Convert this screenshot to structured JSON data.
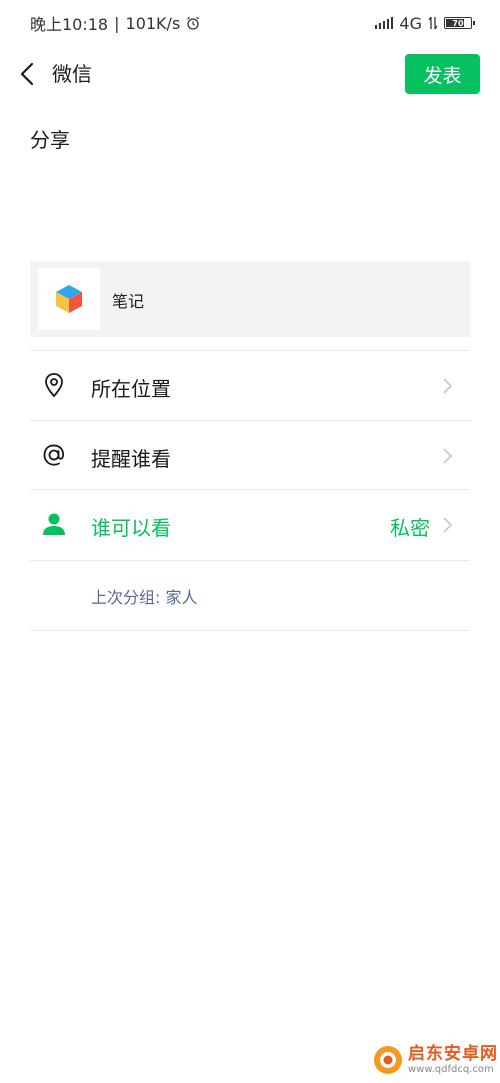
{
  "status_bar": {
    "time": "晚上10:18",
    "separator": "|",
    "speed": "101K/s",
    "network": "4G",
    "battery": "70"
  },
  "nav": {
    "title": "微信",
    "publish_label": "发表"
  },
  "compose": {
    "text": "分享"
  },
  "share_card": {
    "label": "笔记"
  },
  "options": [
    {
      "label": "所在位置",
      "icon": "location-pin-icon"
    },
    {
      "label": "提醒谁看",
      "icon": "at-sign-icon"
    },
    {
      "label": "谁可以看",
      "value": "私密",
      "icon": "person-icon"
    }
  ],
  "last_group": "上次分组: 家人",
  "watermark": {
    "title": "启东安卓网",
    "subtitle": "www.qdfdcq.com"
  },
  "colors": {
    "accent": "#07c160",
    "link": "#576b95"
  }
}
